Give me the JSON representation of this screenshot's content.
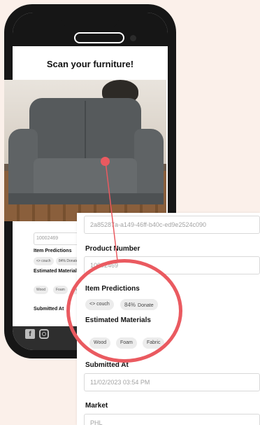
{
  "app": {
    "title": "Scan your furniture!",
    "product_number_value": "10002469",
    "item_predictions_label": "Item Predictions",
    "prediction_chip": "<> couch",
    "prediction_pct": "84%",
    "prediction_action": "Donate",
    "estimated_materials_label": "Estimated Materials",
    "materials": [
      "Wood",
      "Foam",
      "Fabric"
    ],
    "submitted_at_label": "Submitted At"
  },
  "zoom": {
    "id_value": "2a85287a-a149-46ff-b40c-ed9e2524c090",
    "product_number_label": "Product Number",
    "product_number_value": "10002469",
    "item_predictions_label": "Item Predictions",
    "prediction_chip": "<> couch",
    "prediction_pct": "84%",
    "prediction_action": "Donate",
    "estimated_materials_label": "Estimated Materials",
    "materials": [
      "Wood",
      "Foam",
      "Fabric"
    ],
    "submitted_at_label": "Submitted At",
    "submitted_at_value": "11/02/2023 03:54 PM",
    "market_label": "Market",
    "market_value": "PHL"
  },
  "icons": {
    "social_1": "facebook-icon",
    "social_2": "instagram-icon"
  },
  "colors": {
    "background": "#fbf0ea",
    "accent": "#ea5a60",
    "phone": "#161616"
  }
}
